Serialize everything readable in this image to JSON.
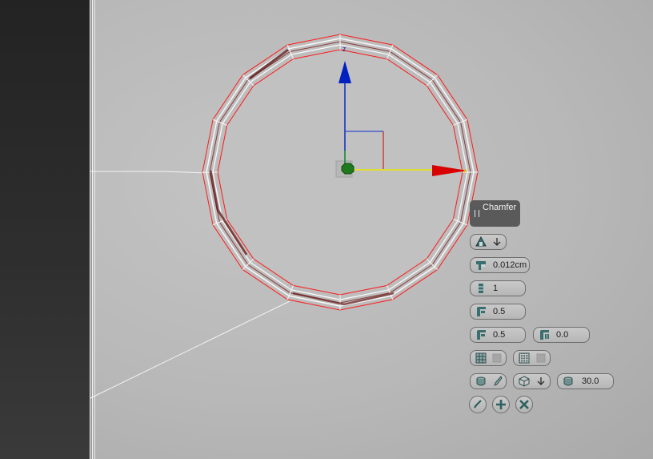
{
  "caddy": {
    "title": "Chamfer",
    "rows": [
      {
        "fields": [
          {
            "name": "chamfer-type",
            "icon": "chamfer-type-icon",
            "value": ""
          }
        ]
      },
      {
        "fields": [
          {
            "name": "amount",
            "icon": "amount-icon",
            "value": "0.012cm"
          }
        ]
      },
      {
        "fields": [
          {
            "name": "segments",
            "icon": "segments-icon",
            "value": "1"
          }
        ]
      },
      {
        "fields": [
          {
            "name": "tension",
            "icon": "tension-icon",
            "value": "0.5"
          }
        ]
      },
      {
        "fields": [
          {
            "name": "depth",
            "icon": "depth-icon",
            "value": "0.5"
          },
          {
            "name": "inset",
            "icon": "inset-icon",
            "value": "0.0"
          }
        ]
      },
      {
        "fields": [
          {
            "name": "end-bias",
            "icon": "end-bias-icon",
            "value": ""
          },
          {
            "name": "radial-bias",
            "icon": "radial-bias-icon",
            "value": ""
          }
        ]
      },
      {
        "fields": [
          {
            "name": "smooth",
            "icon": "smooth-icon",
            "value": ""
          },
          {
            "name": "smooth-type",
            "icon": "smooth-type-icon",
            "value": ""
          },
          {
            "name": "smooth-threshold",
            "icon": "smooth-threshold-icon",
            "value": "30.0"
          }
        ]
      }
    ],
    "actions": [
      {
        "name": "ok-button",
        "icon": "checkmark-icon"
      },
      {
        "name": "apply-button",
        "icon": "plus-icon"
      },
      {
        "name": "cancel-button",
        "icon": "x-icon"
      }
    ]
  },
  "colors": {
    "x_axis": "#d80000",
    "y_axis_line": "#e8e800",
    "z_axis": "#0020c0",
    "pivot": "#1f7a1f",
    "selection_outline": "#ff0000",
    "selected_edge": "#6b2020"
  }
}
